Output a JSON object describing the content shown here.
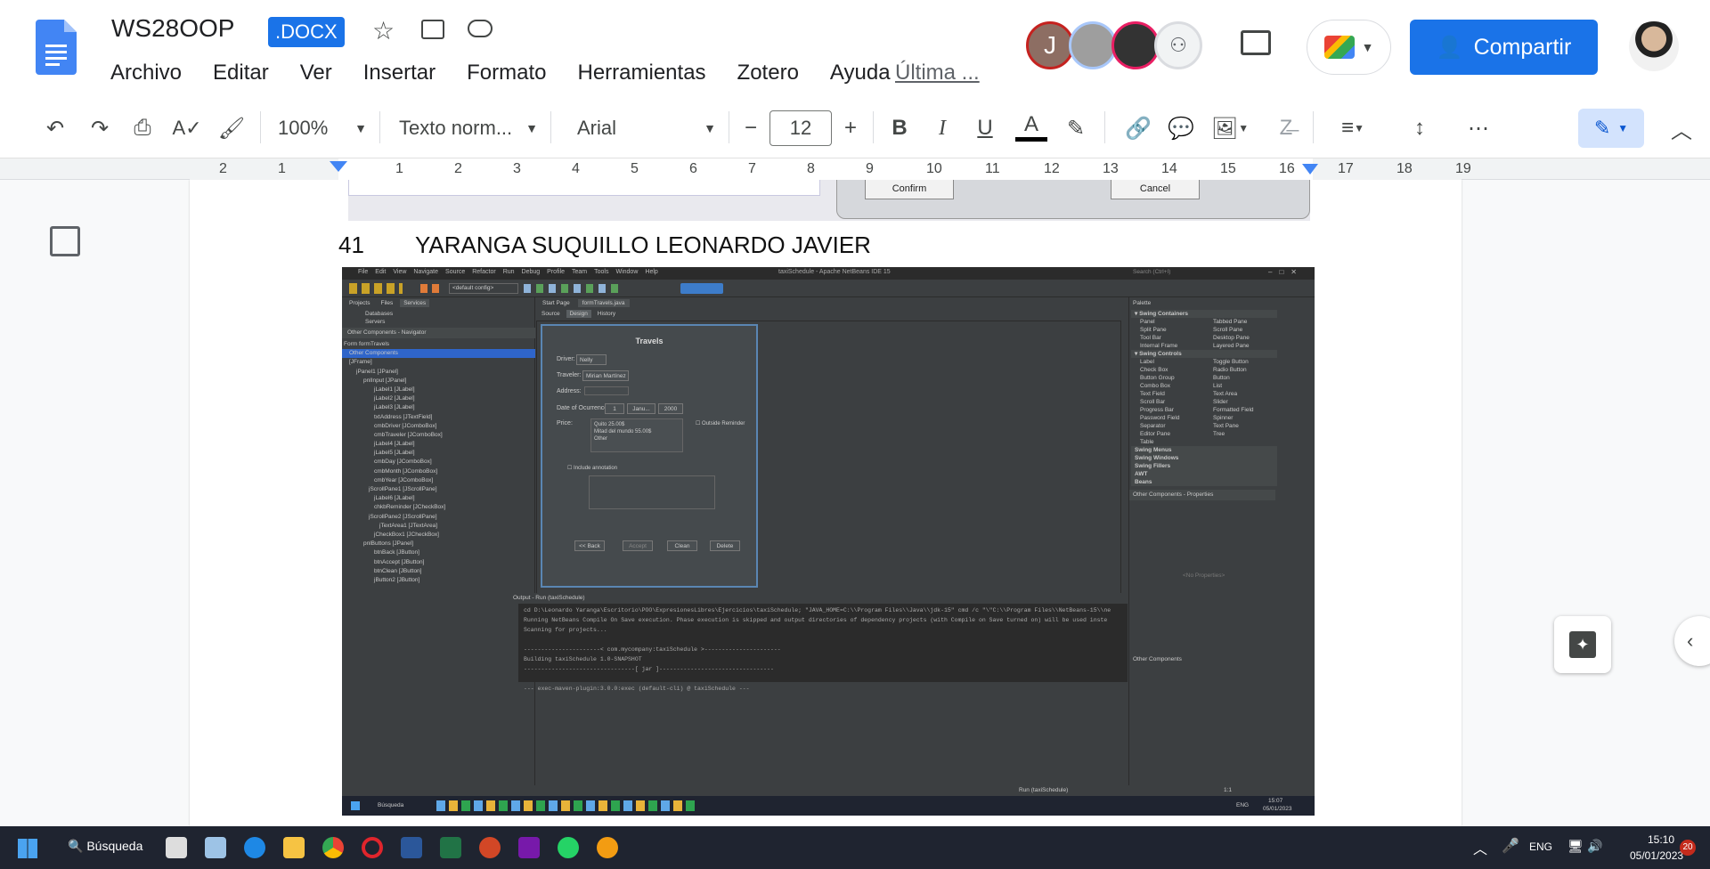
{
  "doc": {
    "title": "WS28OOP",
    "format_badge": ".DOCX",
    "last_edit": "Última ...",
    "share": "Compartir",
    "avatar_initial": "J"
  },
  "menu": [
    "Archivo",
    "Editar",
    "Ver",
    "Insertar",
    "Formato",
    "Herramientas",
    "Zotero",
    "Ayuda"
  ],
  "toolbar": {
    "zoom": "100%",
    "style": "Texto norm...",
    "font": "Arial",
    "font_size": "12"
  },
  "ruler": [
    "2",
    "1",
    "1",
    "2",
    "3",
    "4",
    "5",
    "6",
    "7",
    "8",
    "9",
    "10",
    "11",
    "12",
    "13",
    "14",
    "15",
    "16",
    "17",
    "18",
    "19"
  ],
  "prev_dialog": {
    "confirm": "Confirm",
    "cancel": "Cancel"
  },
  "entry": {
    "number": "41",
    "name": "YARANGA SUQUILLO LEONARDO JAVIER"
  },
  "ide": {
    "window_title": "taxiSchedule - Apache NetBeans IDE 15",
    "menus": [
      "File",
      "Edit",
      "View",
      "Navigate",
      "Source",
      "Refactor",
      "Run",
      "Debug",
      "Profile",
      "Team",
      "Tools",
      "Window",
      "Help"
    ],
    "search_placeholder": "Search (Ctrl+I)",
    "config": "<default config>",
    "left_tabs": [
      "Projects",
      "Files",
      "Services"
    ],
    "services": [
      "Databases",
      "Servers"
    ],
    "navigator_title": "Other Components - Navigator",
    "tree": [
      "Form formTravels",
      "Other Components",
      "[JFrame]",
      "jPanel1 [JPanel]",
      "pnlInput [JPanel]",
      "jLabel1 [JLabel]",
      "jLabel2 [JLabel]",
      "jLabel3 [JLabel]",
      "txtAddress [JTextField]",
      "cmbDriver [JComboBox]",
      "cmbTraveler [JComboBox]",
      "jLabel4 [JLabel]",
      "jLabel5 [JLabel]",
      "cmbDay [JComboBox]",
      "cmbMonth [JComboBox]",
      "cmbYear [JComboBox]",
      "jScrollPane1 [JScrollPane]",
      "jLabel6 [JLabel]",
      "chkbReminder [JCheckBox]",
      "jScrollPane2 [JScrollPane]",
      "jTextArea1 [JTextArea]",
      "jCheckBox1 [JCheckBox]",
      "pnlButtons [JPanel]",
      "btnBack [JButton]",
      "btnAccept [JButton]",
      "btnClean [JButton]",
      "jButton2 [JButton]"
    ],
    "editor_tabs": [
      "Start Page",
      "formTravels.java"
    ],
    "editor_modes": [
      "Source",
      "Design",
      "History"
    ],
    "form": {
      "title": "Travels",
      "driver_lbl": "Driver:",
      "driver_val": "Nelly",
      "traveler_lbl": "Traveler:",
      "traveler_val": "Mirian Martínez",
      "address_lbl": "Address:",
      "date_lbl": "Date of Ocurrence:",
      "day": "1",
      "month": "Janu...",
      "year": "2000",
      "price_lbl": "Price:",
      "prices": [
        "Quito 25.00$",
        "Mitad del mundo 55.00$",
        "Other"
      ],
      "reminder": "Outside Reminder",
      "annotation": "Include annotation",
      "back": "<< Back",
      "accept": "Accept",
      "clean": "Clean",
      "delete": "Delete"
    },
    "palette_title": "Palette",
    "palette": {
      "Swing Containers": [
        "Panel",
        "Tabbed Pane",
        "Split Pane",
        "Scroll Pane",
        "Tool Bar",
        "Desktop Pane",
        "Internal Frame",
        "Layered Pane"
      ],
      "Swing Controls": [
        "Label",
        "Toggle Button",
        "Check Box",
        "Radio Button",
        "Button Group",
        "Button",
        "Combo Box",
        "List",
        "Text Field",
        "Text Area",
        "Scroll Bar",
        "Slider",
        "Progress Bar",
        "Formatted Field",
        "Password Field",
        "Spinner",
        "Separator",
        "Text Pane",
        "Editor Pane",
        "Tree",
        "Table"
      ],
      "more": [
        "Swing Menus",
        "Swing Windows",
        "Swing Fillers",
        "AWT",
        "Beans"
      ]
    },
    "properties_title": "Other Components - Properties",
    "no_properties": "<No Properties>",
    "other_components": "Other Components",
    "output_title": "Output - Run (taxiSchedule)",
    "output": [
      "cd D:\\Leonardo Yaranga\\Escritorio\\POO\\ExpresionesLibres\\Ejercicios\\taxiSchedule; \"JAVA_HOME=C:\\\\Program Files\\\\Java\\\\jdk-15\" cmd /c \"\\\"C:\\\\Program Files\\\\NetBeans-15\\\\ne",
      "Running NetBeans Compile On Save execution. Phase execution is skipped and output directories of dependency projects (with Compile on Save turned on) will be used inste",
      "Scanning for projects...",
      "",
      "----------------------< com.mycompany:taxiSchedule >----------------------",
      "Building taxiSchedule 1.0-SNAPSHOT",
      "--------------------------------[ jar ]---------------------------------",
      "",
      "--- exec-maven-plugin:3.0.0:exec (default-cli) @ taxiSchedule ---"
    ],
    "status_run": "Run (taxiSchedule)",
    "status_pos": "1:1",
    "inner_search": "Búsqueda",
    "inner_lang": "ENG",
    "inner_time": "15:07",
    "inner_date": "05/01/2023"
  },
  "taskbar": {
    "search": "Búsqueda",
    "lang": "ENG",
    "time": "15:10",
    "date": "05/01/2023",
    "notifications": "20"
  }
}
